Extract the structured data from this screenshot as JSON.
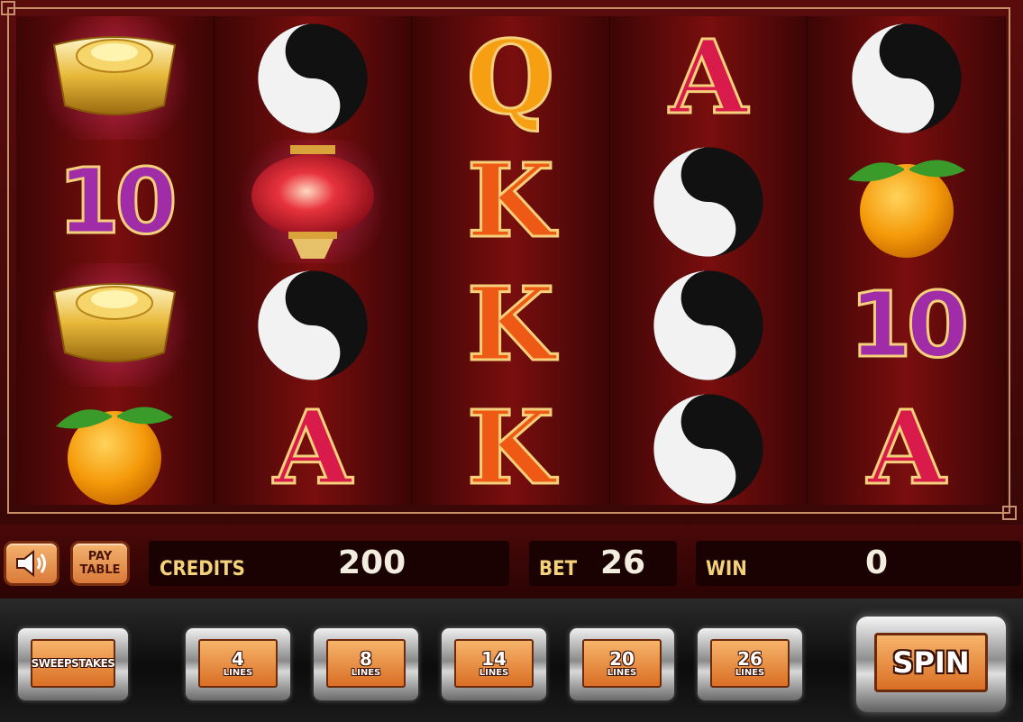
{
  "reels": [
    [
      "gold-ingot",
      "10",
      "gold-ingot",
      "orange"
    ],
    [
      "yin-yang",
      "lantern",
      "yin-yang",
      "A"
    ],
    [
      "Q",
      "K",
      "K",
      "K"
    ],
    [
      "A",
      "yin-yang",
      "yin-yang",
      "yin-yang"
    ],
    [
      "yin-yang",
      "orange",
      "10",
      "A"
    ]
  ],
  "symbols": {
    "A": "A",
    "K": "K",
    "Q": "Q",
    "ten": "10"
  },
  "info_bar": {
    "paytable_line1": "PAY",
    "paytable_line2": "TABLE",
    "credits_label": "CREDITS",
    "credits_value": "200",
    "bet_label": "BET",
    "bet_value": "26",
    "win_label": "WIN",
    "win_value": "0"
  },
  "buttons": {
    "sweepstakes": "SWEEPSTAKES",
    "lines": [
      {
        "num": "4",
        "unit": "LINES"
      },
      {
        "num": "8",
        "unit": "LINES"
      },
      {
        "num": "14",
        "unit": "LINES"
      },
      {
        "num": "20",
        "unit": "LINES"
      },
      {
        "num": "26",
        "unit": "LINES"
      }
    ],
    "spin": "SPIN"
  },
  "colors": {
    "frame": "#c7906b",
    "reel": "#7a0e0e",
    "label": "#f3d27a",
    "button": "#e8893e"
  }
}
